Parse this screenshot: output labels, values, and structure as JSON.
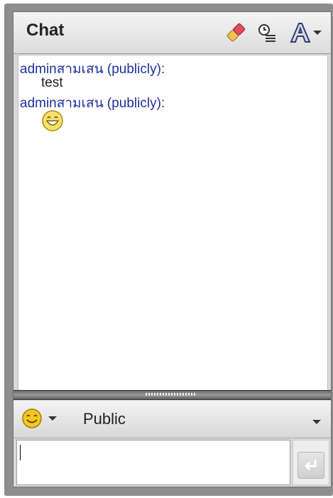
{
  "header": {
    "title": "Chat"
  },
  "icons": {
    "clear": "eraser-icon",
    "status": "status-list-icon",
    "font": "font-size-icon",
    "emoticon": "smiley-icon",
    "send": "enter-arrow-icon"
  },
  "messages": [
    {
      "sender": "adminสามเสน (publicly):",
      "body": "test"
    },
    {
      "sender": "adminสามเสน (publicly):",
      "body": ""
    }
  ],
  "composer": {
    "recipient": "Public",
    "input_value": ""
  },
  "colors": {
    "sender_text": "#1f2fa0",
    "panel_bg": "#d9d9d9",
    "frame_bg": "#8e8e8e"
  }
}
